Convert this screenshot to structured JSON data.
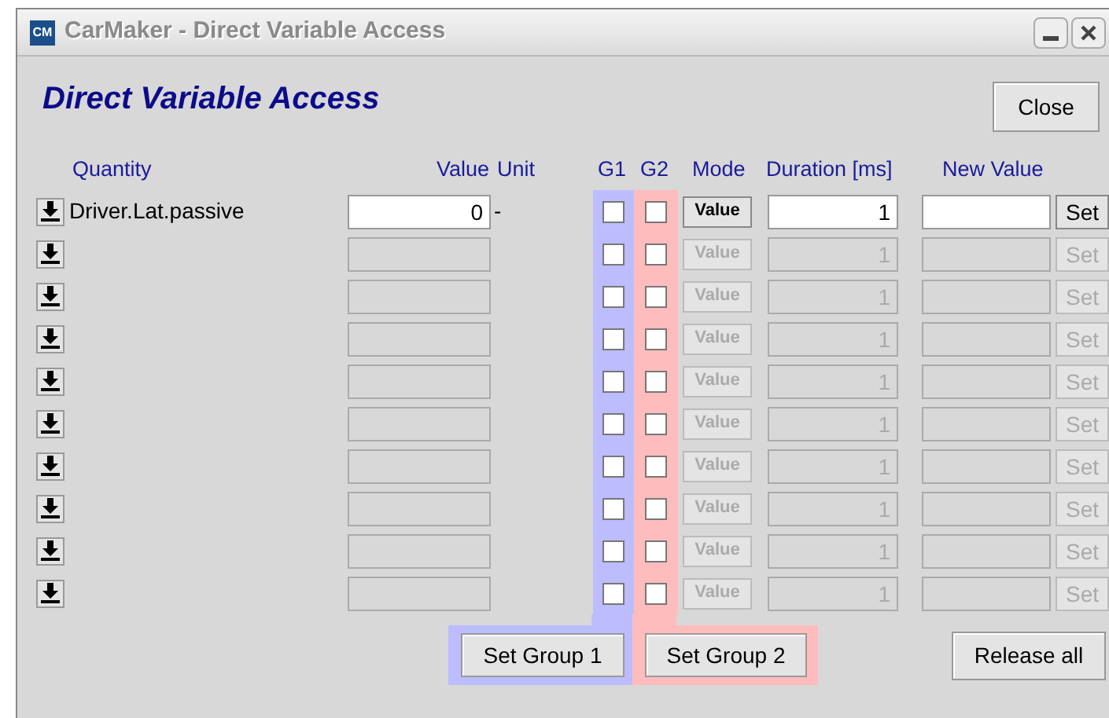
{
  "window": {
    "app_icon": "CM",
    "title": "CarMaker - Direct Variable Access"
  },
  "heading": "Direct Variable Access",
  "close_button": "Close",
  "columns": [
    "Quantity",
    "Value",
    "Unit",
    "G1",
    "G2",
    "Mode",
    "Duration [ms]",
    "New Value"
  ],
  "rows": [
    {
      "quantity": "Driver.Lat.passive",
      "value": "0",
      "unit": "-",
      "g1": false,
      "g2": false,
      "mode": "Value",
      "duration": "1",
      "set": "Set",
      "disabled": false
    },
    {
      "g1": false,
      "g2": false,
      "mode": "Value",
      "duration": "1",
      "set": "Set",
      "disabled": true
    },
    {
      "g1": false,
      "g2": false,
      "mode": "Value",
      "duration": "1",
      "set": "Set",
      "disabled": true
    },
    {
      "g1": false,
      "g2": false,
      "mode": "Value",
      "duration": "1",
      "set": "Set",
      "disabled": true
    },
    {
      "g1": false,
      "g2": false,
      "mode": "Value",
      "duration": "1",
      "set": "Set",
      "disabled": true
    },
    {
      "g1": false,
      "g2": false,
      "mode": "Value",
      "duration": "1",
      "set": "Set",
      "disabled": true
    },
    {
      "g1": false,
      "g2": false,
      "mode": "Value",
      "duration": "1",
      "set": "Set",
      "disabled": true
    },
    {
      "g1": false,
      "g2": false,
      "mode": "Value",
      "duration": "1",
      "set": "Set",
      "disabled": true
    },
    {
      "g1": false,
      "g2": false,
      "mode": "Value",
      "duration": "1",
      "set": "Set",
      "disabled": true
    },
    {
      "g1": false,
      "g2": false,
      "mode": "Value",
      "duration": "1",
      "set": "Set",
      "disabled": true
    }
  ],
  "buttons": {
    "set_group_1": "Set Group 1",
    "set_group_2": "Set Group 2",
    "release_all": "Release all"
  }
}
